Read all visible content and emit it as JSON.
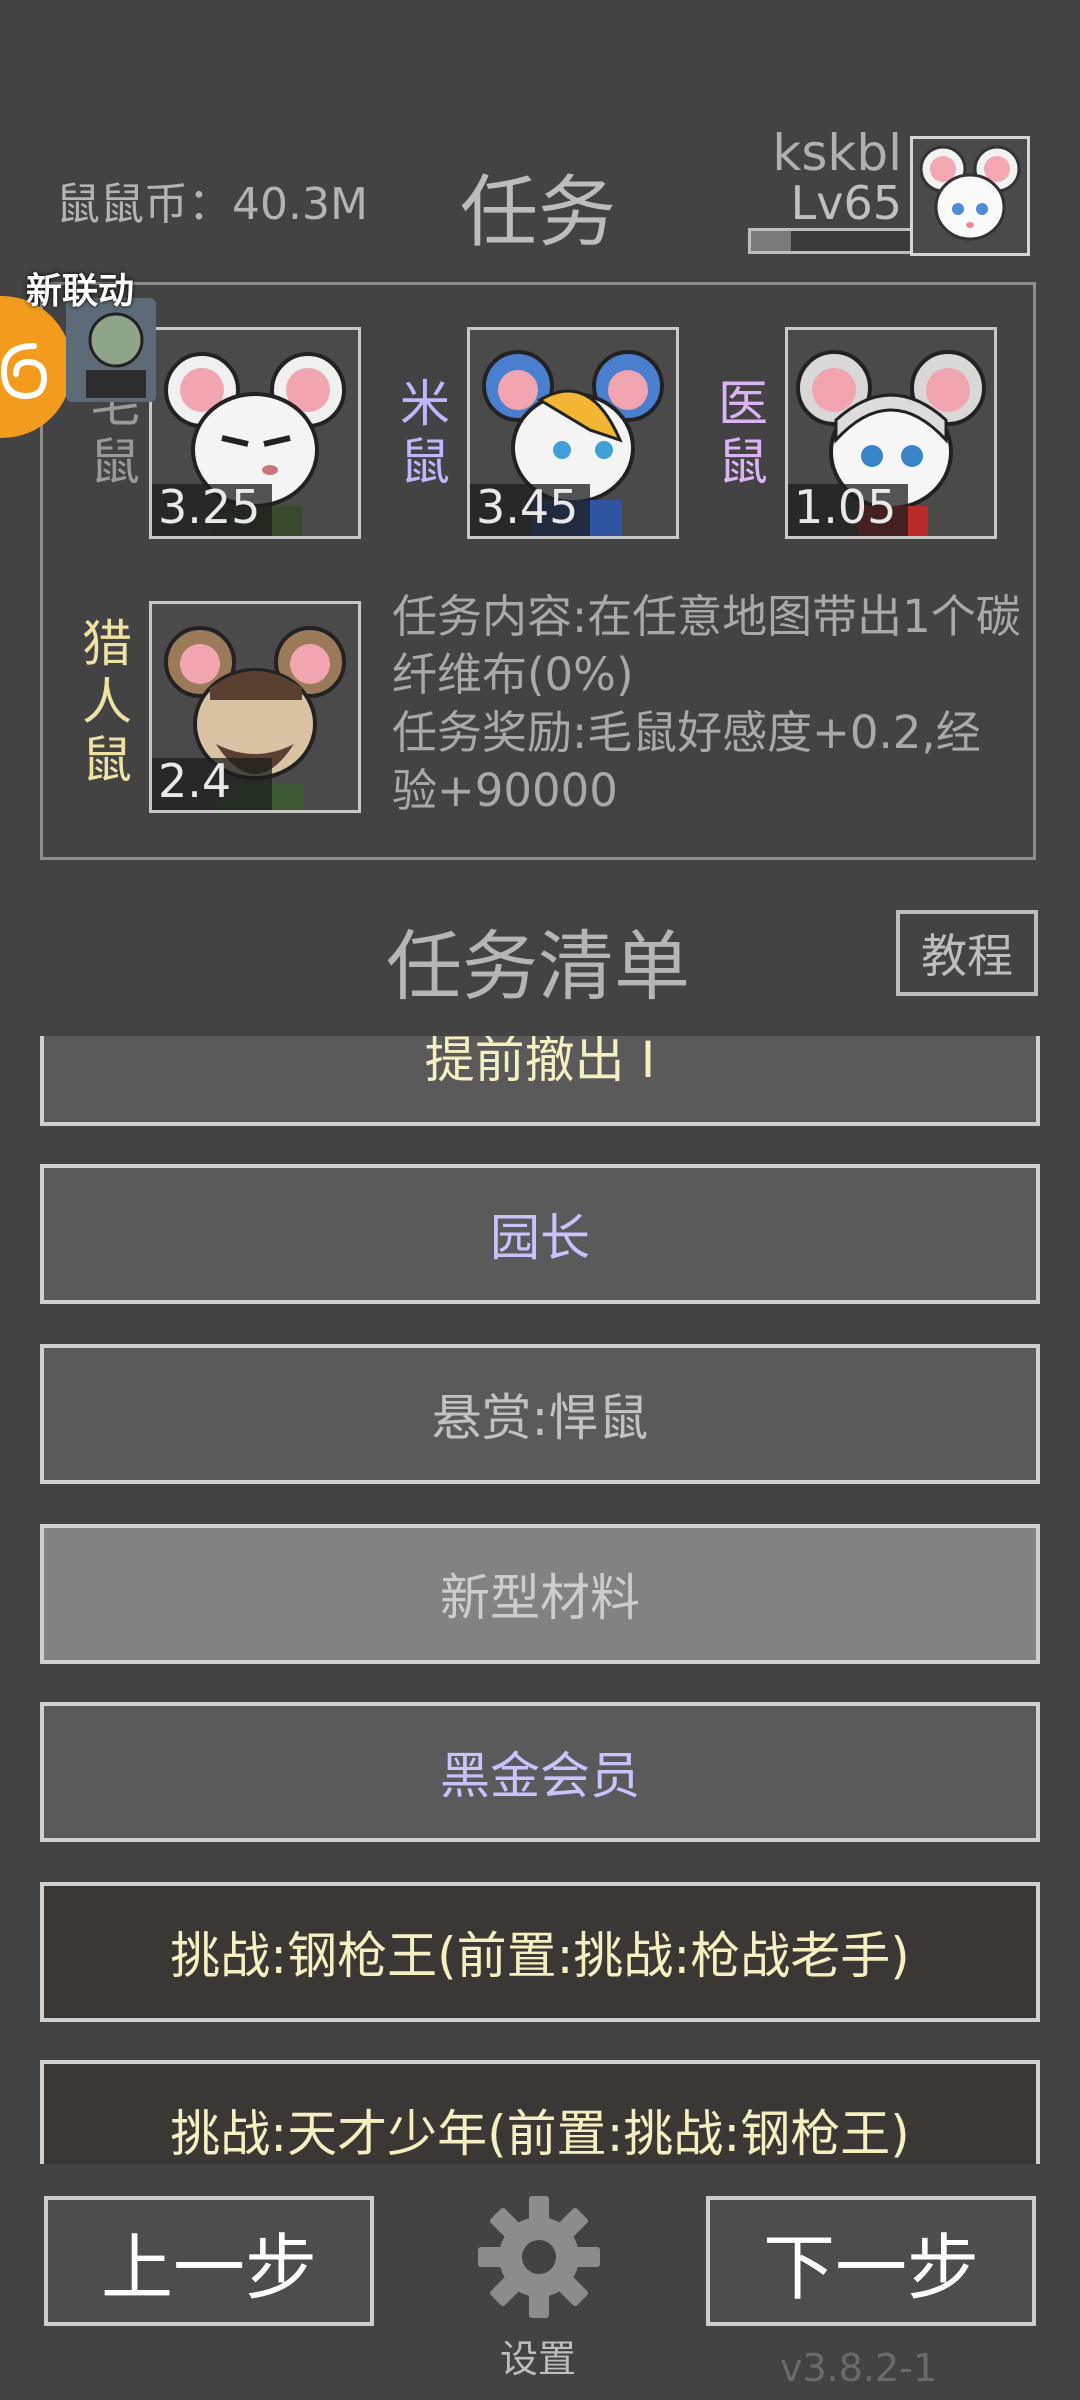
{
  "header": {
    "coins_label": "鼠鼠币：40.3M",
    "title": "任务",
    "username": "kskbl",
    "level": "Lv65",
    "xp_progress": 0.25
  },
  "event": {
    "label": "新联动",
    "icon": "spiral-ear-icon"
  },
  "rats": [
    {
      "name_top": "毛",
      "name_bottom": "鼠",
      "value": "3.25",
      "name_color": "#9a9a9a"
    },
    {
      "name_top": "米",
      "name_bottom": "鼠",
      "value": "3.45",
      "name_color": "#bcb7ff"
    },
    {
      "name_top": "医",
      "name_bottom": "鼠",
      "value": "1.05",
      "name_color": "#dcb4f6"
    },
    {
      "name_top": "猎",
      "name_middle": "人",
      "name_bottom": "鼠",
      "value": "2.4",
      "name_color": "#eee2a3"
    }
  ],
  "mission": {
    "content": "任务内容:在任意地图带出1个碳纤维布(0%)",
    "reward": "任务奖励:毛鼠好感度+0.2,经验+90000"
  },
  "list": {
    "title": "任务清单",
    "tutorial_label": "教程",
    "tasks": [
      {
        "label": "提前撤出 I"
      },
      {
        "label": "园长"
      },
      {
        "label": "悬赏:悍鼠"
      },
      {
        "label": "新型材料"
      },
      {
        "label": "黑金会员"
      },
      {
        "label": "挑战:钢枪王(前置:挑战:枪战老手)"
      },
      {
        "label": "挑战:天才少年(前置:挑战:钢枪王)"
      }
    ]
  },
  "footer": {
    "prev_label": "上一步",
    "next_label": "下一步",
    "settings_label": "设置",
    "version": "v3.8.2-1"
  }
}
